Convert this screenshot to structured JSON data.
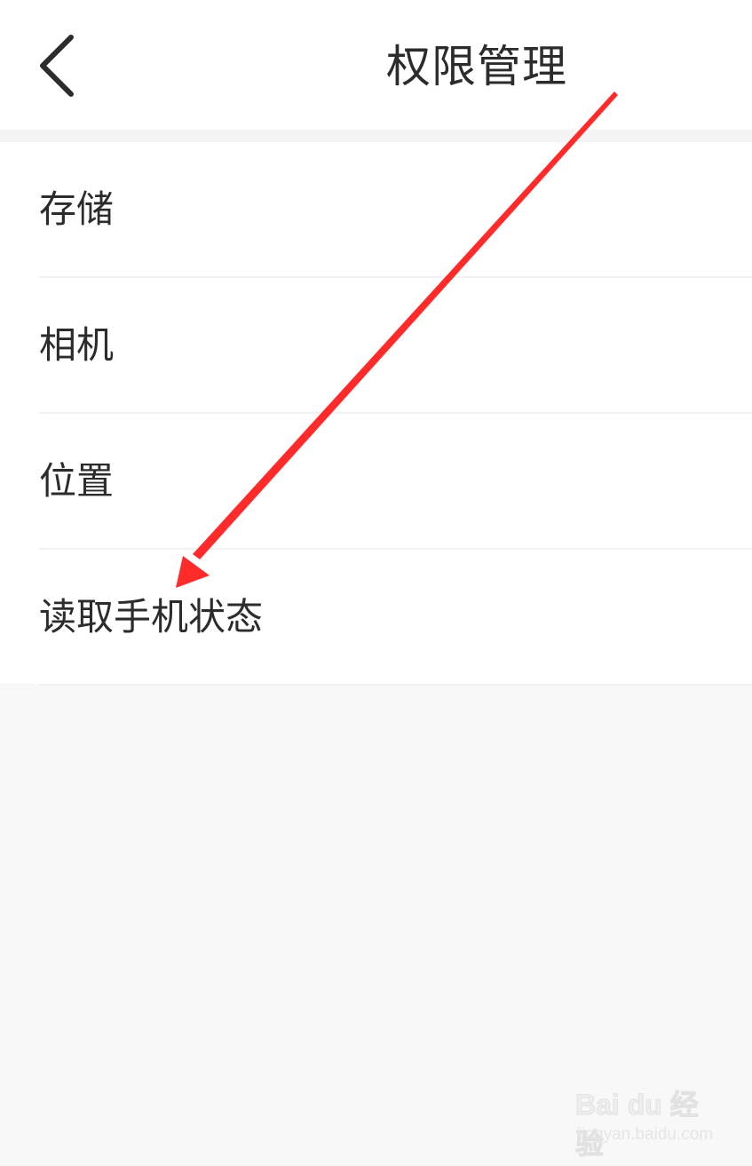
{
  "header": {
    "title": "权限管理",
    "back_icon": "chevron-left-icon"
  },
  "permissions": [
    {
      "label": "存储"
    },
    {
      "label": "相机"
    },
    {
      "label": "位置"
    },
    {
      "label": "读取手机状态"
    }
  ],
  "annotation": {
    "arrow_color": "#ff2a2a"
  },
  "watermark": {
    "logo": "Bai du 经验",
    "url": "jingyan.baidu.com"
  }
}
